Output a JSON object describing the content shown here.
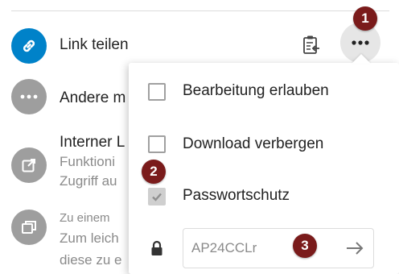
{
  "rows": {
    "share_link": {
      "label": "Link teilen",
      "icon": "link-icon"
    },
    "others": {
      "label": "Andere m",
      "icon": "more-icon"
    },
    "internal_link": {
      "title": "Interner L",
      "line1": "Funktioni",
      "line2": "Zugriff au",
      "icon": "external-link-icon"
    },
    "info": {
      "line1": "Zu einem",
      "line2": "Zum leich",
      "line3": "diese zu e",
      "icon": "window-icon"
    }
  },
  "menu": {
    "options": [
      {
        "label": "Bearbeitung erlauben",
        "checked": false
      },
      {
        "label": "Download verbergen",
        "checked": false
      },
      {
        "label": "Passwortschutz",
        "checked": true
      }
    ],
    "password": {
      "value": "AP24CCLr"
    }
  },
  "badges": [
    "1",
    "2",
    "3"
  ],
  "colors": {
    "accent": "#0082c9",
    "badge": "#7a1b1b",
    "muted_icon": "#9e9e9e"
  }
}
